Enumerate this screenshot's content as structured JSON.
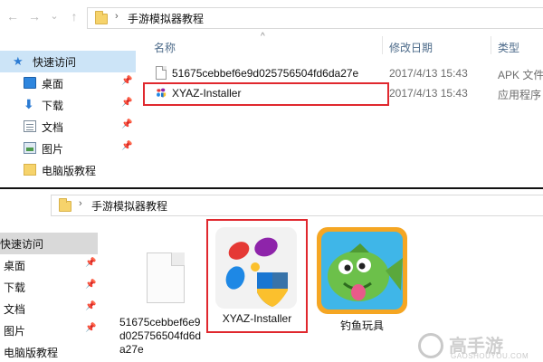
{
  "top_window": {
    "nav_back": "←",
    "nav_forward": "→",
    "breadcrumb_separator": "›",
    "breadcrumb": "手游模拟器教程",
    "nav_items": [
      {
        "label": "快速访问",
        "icon": "star-icon"
      },
      {
        "label": "桌面",
        "icon": "desktop-icon",
        "pinned": true
      },
      {
        "label": "下载",
        "icon": "download-icon",
        "pinned": true
      },
      {
        "label": "文档",
        "icon": "document-icon",
        "pinned": true
      },
      {
        "label": "图片",
        "icon": "picture-icon",
        "pinned": true
      },
      {
        "label": "电脑版教程",
        "icon": "folder-icon"
      }
    ],
    "columns": {
      "name": "名称",
      "modified": "修改日期",
      "type": "类型"
    },
    "files": [
      {
        "name": "51675cebbef6e9d025756504fd6da27e",
        "modified": "2017/4/13 15:43",
        "type": "APK 文件"
      },
      {
        "name": "XYAZ-Installer",
        "modified": "2017/4/13 15:43",
        "type": "应用程序"
      }
    ]
  },
  "bottom_window": {
    "breadcrumb_separator": "›",
    "breadcrumb": "手游模拟器教程",
    "nav_items": [
      {
        "label": "快速访问"
      },
      {
        "label": "桌面",
        "pinned": true
      },
      {
        "label": "下载",
        "pinned": true
      },
      {
        "label": "文档",
        "pinned": true
      },
      {
        "label": "图片",
        "pinned": true
      },
      {
        "label": "电脑版教程"
      }
    ],
    "tiles": [
      {
        "caption": "51675cebbef6e9d025756504fd6da27e",
        "icon": "blank-file-icon"
      },
      {
        "caption": "XYAZ-Installer",
        "icon": "xyaz-installer-icon"
      },
      {
        "caption": "钓鱼玩具",
        "icon": "fish-game-icon"
      }
    ]
  },
  "watermark": {
    "title": "高手游",
    "subtitle": "GAOSHOUYOU.COM"
  },
  "colors": {
    "highlight": "#e0282e",
    "selected": "#cce4f7",
    "header_text": "#4d6b8a"
  }
}
